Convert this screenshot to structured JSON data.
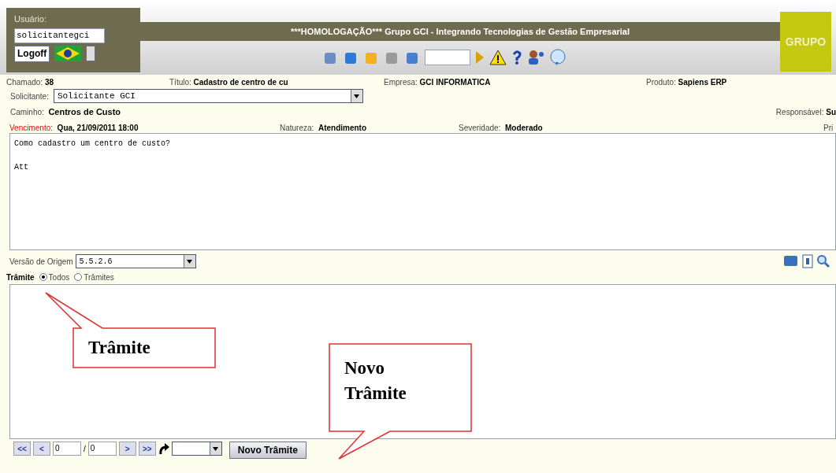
{
  "header": {
    "user_label": "Usuário:",
    "user_value": "solicitantegci",
    "logoff": "Logoff",
    "title": "***HOMOLOGAÇÃO*** Grupo GCI - Integrando Tecnologias de Gestão Empresarial",
    "logo": "GRUPO"
  },
  "row1": [
    {
      "label": "Chamado:",
      "value": "38"
    },
    {
      "label": "Título:",
      "value": "Cadastro de centro de cu"
    },
    {
      "label": "Empresa:",
      "value": "GCI INFORMATICA"
    },
    {
      "label": "Produto:",
      "value": "Sapiens ERP"
    }
  ],
  "solicitante": {
    "label": "Solicitante:",
    "value": "Solicitante GCI"
  },
  "caminho": {
    "label": "Caminho:",
    "value": "Centros de Custo"
  },
  "responsavel": {
    "label": "Responsável:",
    "value": "Su"
  },
  "row4": [
    {
      "label": "Vencimento:",
      "value": "Qua, 21/09/2011 18:00",
      "alert": true
    },
    {
      "label": "Natureza:",
      "value": "Atendimento",
      "alert": false
    },
    {
      "label": "Severidade:",
      "value": "Moderado",
      "alert": false
    },
    {
      "label": "Pri",
      "alert": false
    }
  ],
  "description": "Como cadastro um centro de custo?\n\nAtt",
  "versao": {
    "label": "Versão de Origem",
    "value": "5.5.2.6"
  },
  "tramite": {
    "label": "Trâmite",
    "options": [
      {
        "label": "Todos",
        "selected": true
      },
      {
        "label": "Trâmites",
        "selected": false
      }
    ]
  },
  "pager": {
    "first": "<<",
    "prev": "<",
    "page": "0",
    "sep": "/",
    "total": "0",
    "next": ">",
    "last": ">>"
  },
  "new_button": "Novo Trâmite",
  "callouts": [
    {
      "text": "Trâmite"
    },
    {
      "text": "Novo\nTrâmite"
    }
  ]
}
